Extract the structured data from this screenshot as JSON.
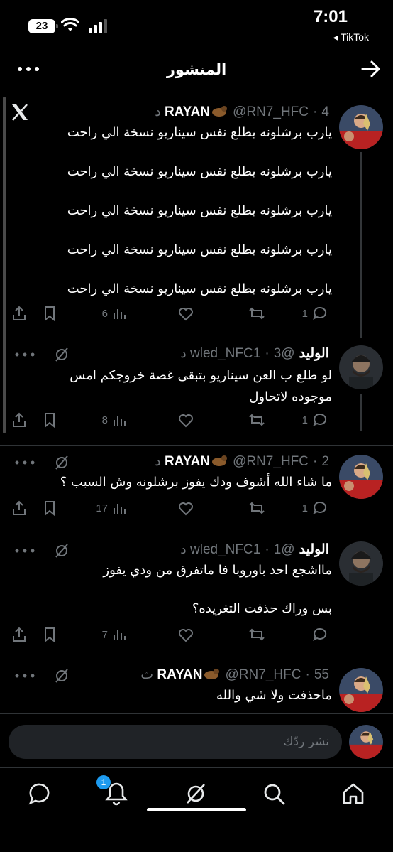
{
  "status_bar": {
    "time": "7:01",
    "back_app": "TikTok",
    "battery": "23"
  },
  "header": {
    "title": "المنشور"
  },
  "posts": [
    {
      "name": "RAYAN",
      "handle": "@RN7_HFC",
      "time": "4 د",
      "lines": [
        "يارب برشلونه يطلع نفس سيناريو نسخة الي راحت",
        "يارب برشلونه يطلع نفس سيناريو نسخة الي راحت",
        "يارب برشلونه يطلع نفس سيناريو نسخة الي راحت",
        "يارب برشلونه يطلع نفس سيناريو نسخة الي راحت",
        "يارب برشلونه يطلع نفس سيناريو نسخة الي راحت"
      ],
      "replies": "1",
      "views": "6"
    },
    {
      "name": "الوليد",
      "handle": "@wled_NFC1",
      "time": "3 د",
      "lines": [
        "لو طلع ب العن سيناريو بتبقى غصة خروجكم امس",
        "موجوده لاتحاول"
      ],
      "replies": "1",
      "views": "8"
    },
    {
      "name": "RAYAN",
      "handle": "@RN7_HFC",
      "time": "2 د",
      "lines": [
        "ما شاء الله أشوف ودك يفوز برشلونه وش السبب ؟"
      ],
      "replies": "1",
      "views": "17"
    },
    {
      "name": "الوليد",
      "handle": "@wled_NFC1",
      "time": "1 د",
      "lines": [
        "مااشجع احد باوروبا فا ماتفرق من ودي يفوز",
        "بس وراك حذفت التغريده؟"
      ],
      "replies": "",
      "views": "7"
    },
    {
      "name": "RAYAN",
      "handle": "@RN7_HFC",
      "time": "55 ث",
      "lines": [
        "ماحذفت ولا شي والله"
      ],
      "replies": "",
      "views": ""
    }
  ],
  "reply": {
    "placeholder": "نشر ردّك"
  },
  "tabbar": {
    "notifications_badge": "1"
  },
  "colors": {
    "background": "#000000",
    "accent": "#1d9bf0",
    "muted": "#71767b",
    "divider": "#2f3336"
  },
  "icons": [
    "arrow-right-icon",
    "more-icon",
    "x-logo-icon",
    "reply-icon",
    "retweet-icon",
    "like-icon",
    "views-icon",
    "bookmark-icon",
    "share-icon",
    "grok-icon",
    "home-icon",
    "search-icon",
    "bell-icon",
    "messages-icon"
  ]
}
